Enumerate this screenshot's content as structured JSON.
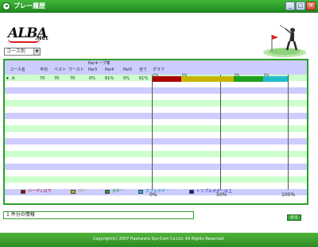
{
  "window": {
    "title": "プレー履歴"
  },
  "logo": {
    "main": "ALBA",
    "sub": ".Net"
  },
  "course_select": {
    "value": "コース別"
  },
  "table": {
    "headers": {
      "course_name": "コース名",
      "average": "平均",
      "best": "ベスト",
      "worst": "ワースト",
      "par_keep_group": "Parキープ率",
      "par3": "Par3",
      "par4": "Par4",
      "par5": "Par5",
      "all": "全て",
      "graph": "グラフ"
    },
    "rows": [
      {
        "marker": "★",
        "course": "A",
        "average": "70",
        "best": "70",
        "worst": "70",
        "par3": "0%",
        "par4": "61%",
        "par5": "0%",
        "all": "61%",
        "segments": [
          {
            "label": "0%",
            "percent": 21,
            "color": "#aa0000"
          },
          {
            "label": "0%",
            "percent": 39,
            "color": "#c8b400"
          },
          {
            "label": "0%",
            "percent": 22,
            "color": "#1fa01f"
          },
          {
            "label": "0%",
            "percent": 18,
            "color": "#22bbcc"
          }
        ]
      }
    ]
  },
  "graph_axis": [
    "0%",
    "50%",
    "100%"
  ],
  "legend": [
    {
      "label": "バーディ以下",
      "color": "#aa0000",
      "text_color": "#aa0000"
    },
    {
      "label": "パー",
      "color": "#c8b400",
      "text_color": "#a08a00"
    },
    {
      "label": "ボギー",
      "color": "#1fa01f",
      "text_color": "#1f8a1f"
    },
    {
      "label": "ダブルボギー",
      "color": "#22bbcc",
      "text_color": "#1b98a8"
    },
    {
      "label": "トリプルボギー以上",
      "color": "#1a1aa0",
      "text_color": "#1a1aa0"
    }
  ],
  "message": {
    "text": "1 件分の情報"
  },
  "back_button": {
    "label": "戻る"
  },
  "footer": {
    "copyright": "Copyright(c) 2007 Hashwara Sys-Com Co.Ltd. All Rights Reserved."
  }
}
